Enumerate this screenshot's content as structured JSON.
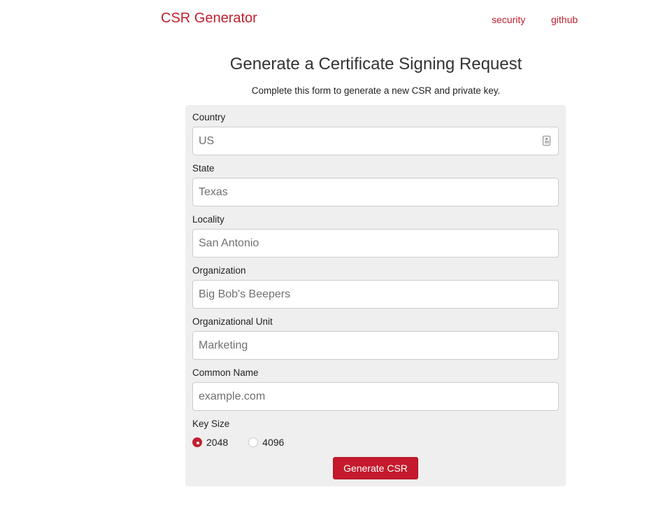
{
  "header": {
    "brand": "CSR Generator",
    "nav": [
      {
        "label": "security"
      },
      {
        "label": "github"
      }
    ]
  },
  "page": {
    "title": "Generate a Certificate Signing Request",
    "subtitle": "Complete this form to generate a new CSR and private key."
  },
  "form": {
    "fields": [
      {
        "label": "Country",
        "placeholder": "US",
        "value": ""
      },
      {
        "label": "State",
        "placeholder": "Texas",
        "value": ""
      },
      {
        "label": "Locality",
        "placeholder": "San Antonio",
        "value": ""
      },
      {
        "label": "Organization",
        "placeholder": "Big Bob's Beepers",
        "value": ""
      },
      {
        "label": "Organizational Unit",
        "placeholder": "Marketing",
        "value": ""
      },
      {
        "label": "Common Name",
        "placeholder": "example.com",
        "value": ""
      }
    ],
    "key_size": {
      "label": "Key Size",
      "options": [
        {
          "label": "2048",
          "checked": true
        },
        {
          "label": "4096",
          "checked": false
        }
      ]
    },
    "submit_label": "Generate CSR"
  },
  "colors": {
    "accent": "#c0202f",
    "panel_bg": "#efefef"
  }
}
